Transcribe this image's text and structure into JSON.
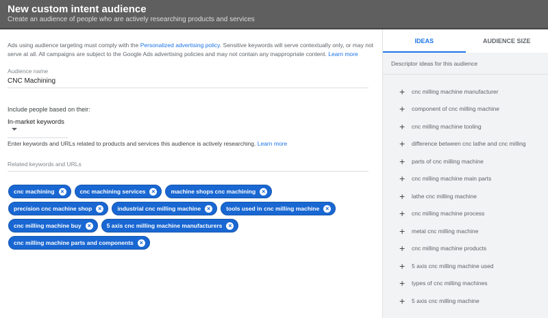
{
  "header": {
    "title": "New custom intent audience",
    "subtitle": "Create an audience of people who are actively researching products and services"
  },
  "notice": {
    "text1": "Ads using audience targeting must comply with the ",
    "policy_link": "Personalized advertising policy",
    "text2": ". Sensitive keywords will serve contextually only, or may not serve at all. All campaigns are subject to the Google Ads advertising policies and may not contain any inappropriate content. ",
    "learn_more": "Learn more"
  },
  "audience_name": {
    "label": "Audience name",
    "value": "CNC Machining"
  },
  "include": {
    "label": "Include people based on their:",
    "selected": "In-market keywords"
  },
  "keywords": {
    "instruction": "Enter keywords and URLs related to products and services this audience is actively researching. ",
    "learn_more": "Learn more",
    "placeholder": "Related keywords and URLs",
    "chips": [
      "cnc machining",
      "cnc machining services",
      "machine shops cnc machining",
      "precision cnc machine shop",
      "industrial cnc milling machine",
      "tools used in cnc milling machine",
      "cnc milling machine buy",
      "5 axis cnc milling machine manufacturers",
      "cnc milling machine parts and components"
    ]
  },
  "side": {
    "tabs": [
      "IDEAS",
      "AUDIENCE SIZE"
    ],
    "description": "Descriptor ideas for this audience",
    "ideas": [
      "cnc milling machine manufacturer",
      "component of cnc milling machine",
      "cnc milling machine tooling",
      "difference between cnc lathe and cnc milling",
      "parts of cnc milling machine",
      "cnc milling machine main parts",
      "lathe cnc milling machine",
      "cnc milling machine process",
      "metal cnc milling machine",
      "cnc milling machine products",
      "5 axis cnc milling machine used",
      "types of cnc milling machines",
      "5 axis cnc milling machine"
    ]
  }
}
